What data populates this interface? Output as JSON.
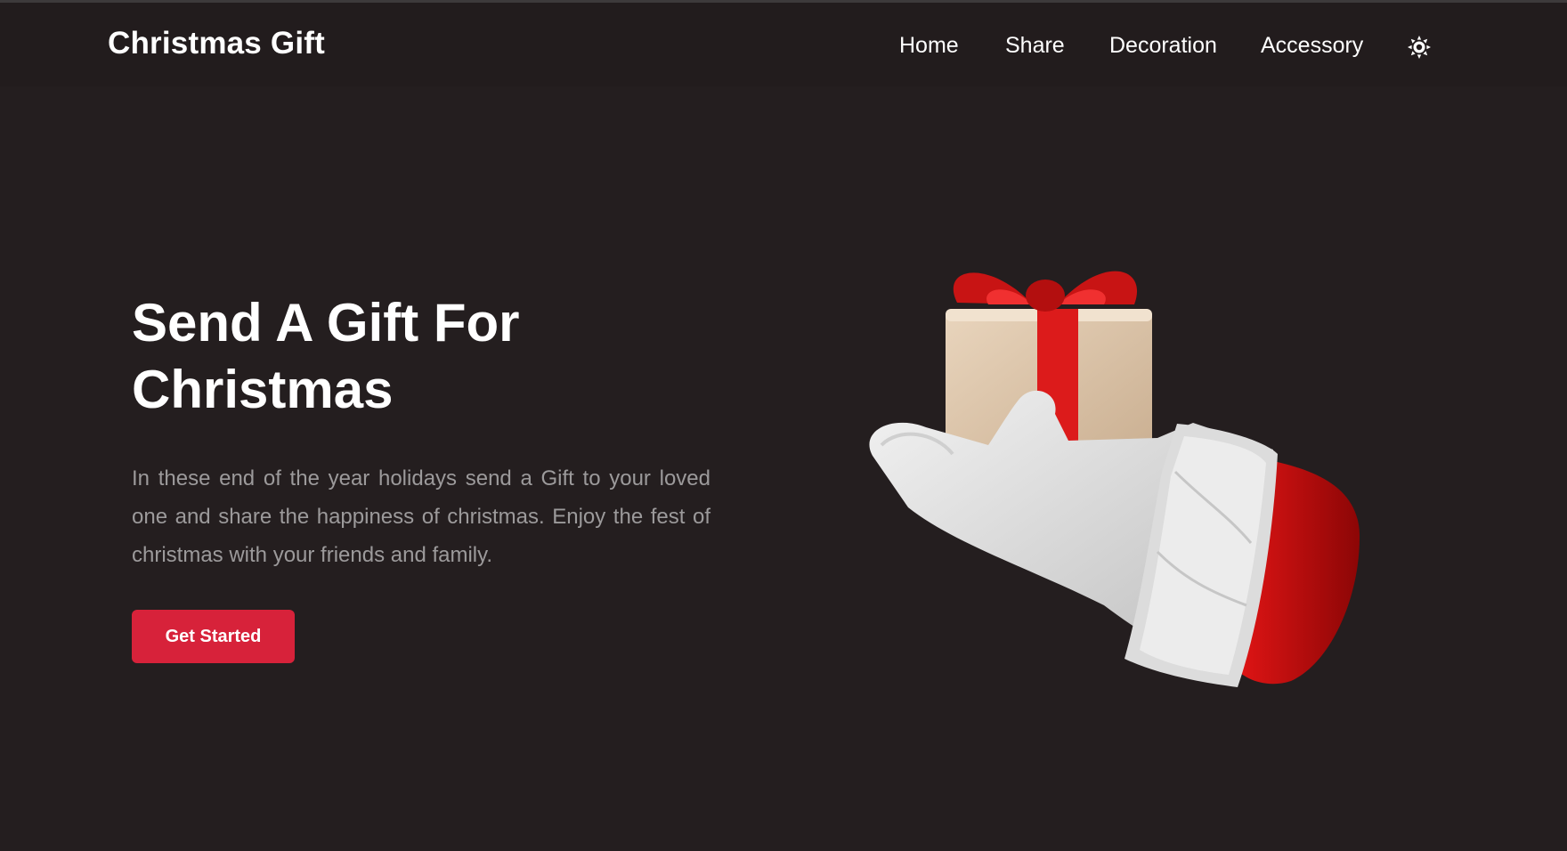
{
  "header": {
    "logo": "Christmas Gift",
    "nav": [
      {
        "label": "Home"
      },
      {
        "label": "Share"
      },
      {
        "label": "Decoration"
      },
      {
        "label": "Accessory"
      }
    ],
    "theme_toggle_icon": "sun-icon"
  },
  "hero": {
    "title": "Send A Gift For Christmas",
    "description": "In these end of the year holidays send a Gift to your loved one and share the happiness of christmas. Enjoy the fest of christmas with your friends and family.",
    "cta_label": "Get Started",
    "illustration": "santa-hand-holding-gift"
  },
  "colors": {
    "background": "#241e1f",
    "header": "#221c1d",
    "accent": "#d7223a",
    "text": "#ffffff",
    "muted_text": "#9c9a9b"
  }
}
